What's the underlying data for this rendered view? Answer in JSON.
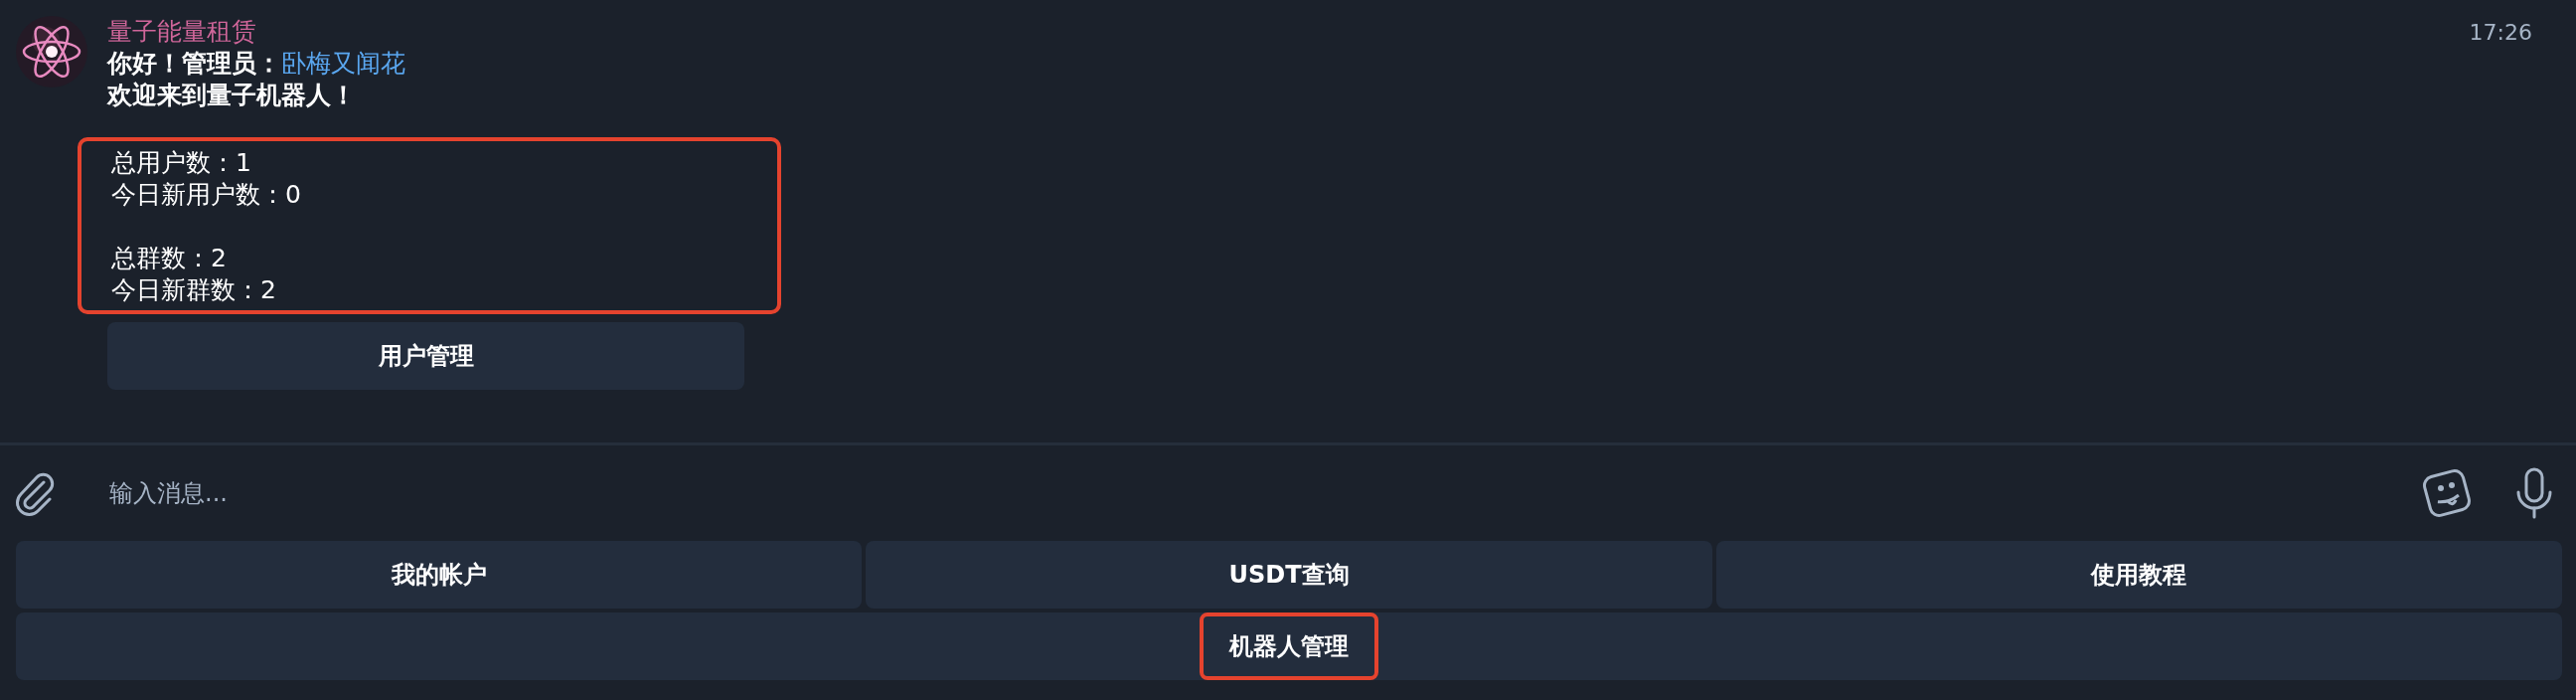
{
  "message": {
    "sender": "量子能量租赁",
    "time": "17:26",
    "greeting": {
      "text": "你好！管理员：",
      "user": "卧梅又闻花"
    },
    "welcome": "欢迎来到量子机器人！",
    "stats": {
      "highlighted": true,
      "groups": [
        [
          "总用户数：1",
          "今日新用户数：0"
        ],
        [
          "总群数：2",
          "今日新群数：2"
        ]
      ]
    },
    "inline_buttons": [
      {
        "label": "用户管理"
      }
    ]
  },
  "composer": {
    "placeholder": "输入消息..."
  },
  "keyboard": [
    [
      {
        "label": "我的帐户",
        "highlighted": false
      },
      {
        "label": "USDT查询",
        "highlighted": false
      },
      {
        "label": "使用教程",
        "highlighted": false
      }
    ],
    [
      {
        "label": "机器人管理",
        "highlighted": true
      }
    ]
  ]
}
